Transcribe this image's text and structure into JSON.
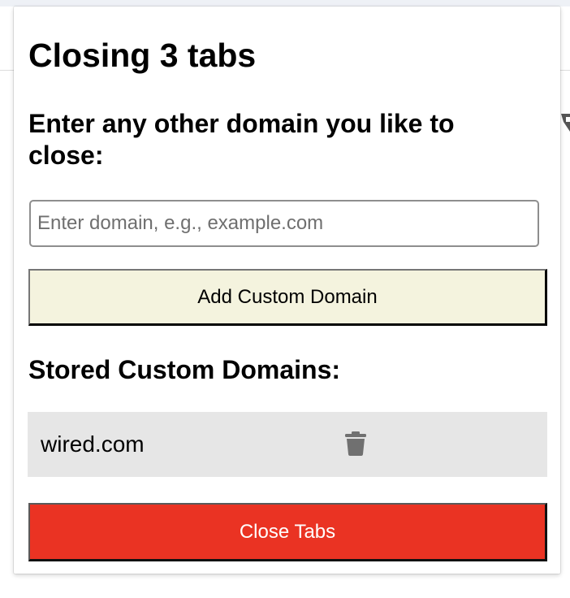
{
  "popup": {
    "title": "Closing 3 tabs",
    "subtitle": "Enter any other domain you like to close:",
    "input": {
      "placeholder": "Enter domain, e.g., example.com",
      "value": ""
    },
    "add_button_label": "Add Custom Domain",
    "stored_heading": "Stored Custom Domains:",
    "stored_domains": [
      {
        "domain": "wired.com",
        "action_icon": "trash-icon"
      }
    ],
    "close_button_label": "Close Tabs"
  },
  "colors": {
    "add_button_bg": "#f4f3de",
    "close_button_bg": "#ea3323",
    "domain_row_bg": "#e6e6e6",
    "trash_icon": "#707070"
  }
}
